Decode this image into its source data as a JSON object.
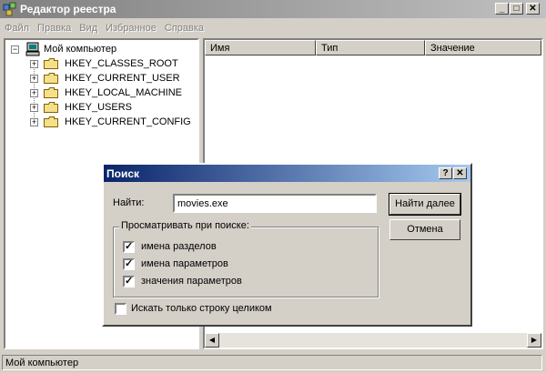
{
  "window": {
    "title": "Редактор реестра"
  },
  "menu": [
    "Файл",
    "Правка",
    "Вид",
    "Избранное",
    "Справка"
  ],
  "tree": {
    "root": "Мой компьютер",
    "items": [
      "HKEY_CLASSES_ROOT",
      "HKEY_CURRENT_USER",
      "HKEY_LOCAL_MACHINE",
      "HKEY_USERS",
      "HKEY_CURRENT_CONFIG"
    ],
    "expander_collapsed": "+",
    "expander_expanded": "−"
  },
  "list": {
    "columns": [
      "Имя",
      "Тип",
      "Значение"
    ]
  },
  "status": {
    "text": "Мой компьютер"
  },
  "dialog": {
    "title": "Поиск",
    "find_label": "Найти:",
    "find_value": "movies.exe",
    "find_next": "Найти далее",
    "cancel": "Отмена",
    "group_label": "Просматривать при поиске:",
    "options": [
      {
        "label": "имена разделов",
        "checked": true
      },
      {
        "label": "имена параметров",
        "checked": true
      },
      {
        "label": "значения параметров",
        "checked": true
      }
    ],
    "whole_string": {
      "label": "Искать только строку целиком",
      "checked": false
    }
  },
  "glyphs": {
    "minimize": "_",
    "maximize": "□",
    "close": "✕",
    "help": "?",
    "check": "✓",
    "scroll_left": "◀",
    "scroll_right": "▶"
  },
  "colors": {
    "dialog_title": "#0a246a",
    "inactive_title": "#808080",
    "face": "#d4d0c8"
  }
}
